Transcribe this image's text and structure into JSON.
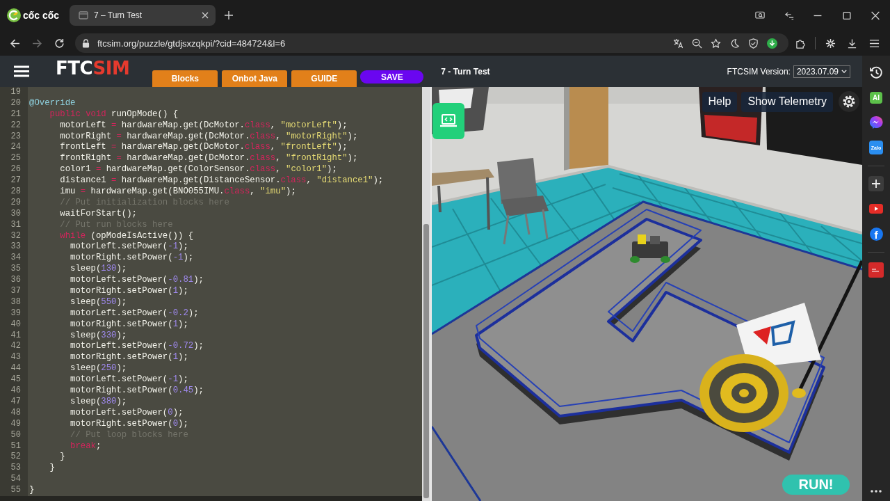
{
  "browser": {
    "brand": "cốc cốc",
    "tab_title": "7 – Turn Test",
    "url": "ftcsim.org/puzzle/gtdjsxzqkpi/?cid=484724&l=6"
  },
  "header": {
    "logo": {
      "text": "FTC",
      "accent": "SIM"
    },
    "tabs": [
      "Blocks",
      "Onbot Java",
      "GUIDE"
    ],
    "save": "SAVE",
    "title": "7 - Turn Test",
    "version_label": "FTCSIM Version:",
    "version": "2023.07.09"
  },
  "editor": {
    "lines": [
      {
        "number": "19"
      },
      {
        "number": "20",
        "tokens": [
          {
            "kind": "annotation",
            "text": "@Override"
          }
        ]
      },
      {
        "number": "21",
        "tokens": [
          {
            "kind": "keyword",
            "text": "    public void"
          },
          {
            "kind": "text",
            "text": " runOpMode() {"
          }
        ]
      },
      {
        "number": "22",
        "tokens": [
          {
            "kind": "text",
            "text": "      motorLeft "
          },
          {
            "kind": "keyword",
            "text": "="
          },
          {
            "kind": "text",
            "text": " hardwareMap.get(DcMotor."
          },
          {
            "kind": "keyword",
            "text": "class"
          },
          {
            "kind": "text",
            "text": ", "
          },
          {
            "kind": "string",
            "text": "\"motorLeft\""
          },
          {
            "kind": "text",
            "text": ");"
          }
        ]
      },
      {
        "number": "23",
        "tokens": [
          {
            "kind": "text",
            "text": "      motorRight "
          },
          {
            "kind": "keyword",
            "text": "="
          },
          {
            "kind": "text",
            "text": " hardwareMap.get(DcMotor."
          },
          {
            "kind": "keyword",
            "text": "class"
          },
          {
            "kind": "text",
            "text": ", "
          },
          {
            "kind": "string",
            "text": "\"motorRight\""
          },
          {
            "kind": "text",
            "text": ");"
          }
        ]
      },
      {
        "number": "24",
        "tokens": [
          {
            "kind": "text",
            "text": "      frontLeft "
          },
          {
            "kind": "keyword",
            "text": "="
          },
          {
            "kind": "text",
            "text": " hardwareMap.get(DcMotor."
          },
          {
            "kind": "keyword",
            "text": "class"
          },
          {
            "kind": "text",
            "text": ", "
          },
          {
            "kind": "string",
            "text": "\"frontLeft\""
          },
          {
            "kind": "text",
            "text": ");"
          }
        ]
      },
      {
        "number": "25",
        "tokens": [
          {
            "kind": "text",
            "text": "      frontRight "
          },
          {
            "kind": "keyword",
            "text": "="
          },
          {
            "kind": "text",
            "text": " hardwareMap.get(DcMotor."
          },
          {
            "kind": "keyword",
            "text": "class"
          },
          {
            "kind": "text",
            "text": ", "
          },
          {
            "kind": "string",
            "text": "\"frontRight\""
          },
          {
            "kind": "text",
            "text": ");"
          }
        ]
      },
      {
        "number": "26",
        "tokens": [
          {
            "kind": "text",
            "text": "      color1 "
          },
          {
            "kind": "keyword",
            "text": "="
          },
          {
            "kind": "text",
            "text": " hardwareMap.get(ColorSensor."
          },
          {
            "kind": "keyword",
            "text": "class"
          },
          {
            "kind": "text",
            "text": ", "
          },
          {
            "kind": "string",
            "text": "\"color1\""
          },
          {
            "kind": "text",
            "text": ");"
          }
        ]
      },
      {
        "number": "27",
        "tokens": [
          {
            "kind": "text",
            "text": "      distance1 "
          },
          {
            "kind": "keyword",
            "text": "="
          },
          {
            "kind": "text",
            "text": " hardwareMap.get(DistanceSensor."
          },
          {
            "kind": "keyword",
            "text": "class"
          },
          {
            "kind": "text",
            "text": ", "
          },
          {
            "kind": "string",
            "text": "\"distance1\""
          },
          {
            "kind": "text",
            "text": ");"
          }
        ]
      },
      {
        "number": "28",
        "tokens": [
          {
            "kind": "text",
            "text": "      imu "
          },
          {
            "kind": "keyword",
            "text": "="
          },
          {
            "kind": "text",
            "text": " hardwareMap.get(BNO055IMU."
          },
          {
            "kind": "keyword",
            "text": "class"
          },
          {
            "kind": "text",
            "text": ", "
          },
          {
            "kind": "string",
            "text": "\"imu\""
          },
          {
            "kind": "text",
            "text": ");"
          }
        ]
      },
      {
        "number": "29",
        "tokens": [
          {
            "kind": "comment",
            "text": "      // Put initialization blocks here"
          }
        ]
      },
      {
        "number": "30",
        "tokens": [
          {
            "kind": "text",
            "text": "      waitForStart();"
          }
        ]
      },
      {
        "number": "31",
        "tokens": [
          {
            "kind": "comment",
            "text": "      // Put run blocks here"
          }
        ]
      },
      {
        "number": "32",
        "tokens": [
          {
            "kind": "keyword",
            "text": "      while"
          },
          {
            "kind": "text",
            "text": " (opModeIsActive()) {"
          }
        ]
      },
      {
        "number": "33",
        "tokens": [
          {
            "kind": "text",
            "text": "        motorLeft.setPower("
          },
          {
            "kind": "number",
            "text": "-1"
          },
          {
            "kind": "text",
            "text": ");"
          }
        ]
      },
      {
        "number": "34",
        "tokens": [
          {
            "kind": "text",
            "text": "        motorRight.setPower("
          },
          {
            "kind": "number",
            "text": "-1"
          },
          {
            "kind": "text",
            "text": ");"
          }
        ]
      },
      {
        "number": "35",
        "tokens": [
          {
            "kind": "text",
            "text": "        sleep("
          },
          {
            "kind": "number",
            "text": "130"
          },
          {
            "kind": "text",
            "text": ");"
          }
        ]
      },
      {
        "number": "36",
        "tokens": [
          {
            "kind": "text",
            "text": "        motorLeft.setPower("
          },
          {
            "kind": "number",
            "text": "-0.81"
          },
          {
            "kind": "text",
            "text": ");"
          }
        ]
      },
      {
        "number": "37",
        "tokens": [
          {
            "kind": "text",
            "text": "        motorRight.setPower("
          },
          {
            "kind": "number",
            "text": "1"
          },
          {
            "kind": "text",
            "text": ");"
          }
        ]
      },
      {
        "number": "38",
        "tokens": [
          {
            "kind": "text",
            "text": "        sleep("
          },
          {
            "kind": "number",
            "text": "550"
          },
          {
            "kind": "text",
            "text": ");"
          }
        ]
      },
      {
        "number": "39",
        "tokens": [
          {
            "kind": "text",
            "text": "        motorLeft.setPower("
          },
          {
            "kind": "number",
            "text": "-0.2"
          },
          {
            "kind": "text",
            "text": ");"
          }
        ]
      },
      {
        "number": "40",
        "tokens": [
          {
            "kind": "text",
            "text": "        motorRight.setPower("
          },
          {
            "kind": "number",
            "text": "1"
          },
          {
            "kind": "text",
            "text": ");"
          }
        ]
      },
      {
        "number": "41",
        "tokens": [
          {
            "kind": "text",
            "text": "        sleep("
          },
          {
            "kind": "number",
            "text": "330"
          },
          {
            "kind": "text",
            "text": ");"
          }
        ]
      },
      {
        "number": "42",
        "tokens": [
          {
            "kind": "text",
            "text": "        motorLeft.setPower("
          },
          {
            "kind": "number",
            "text": "-0.72"
          },
          {
            "kind": "text",
            "text": ");"
          }
        ]
      },
      {
        "number": "43",
        "tokens": [
          {
            "kind": "text",
            "text": "        motorRight.setPower("
          },
          {
            "kind": "number",
            "text": "1"
          },
          {
            "kind": "text",
            "text": ");"
          }
        ]
      },
      {
        "number": "44",
        "tokens": [
          {
            "kind": "text",
            "text": "        sleep("
          },
          {
            "kind": "number",
            "text": "250"
          },
          {
            "kind": "text",
            "text": ");"
          }
        ]
      },
      {
        "number": "45",
        "tokens": [
          {
            "kind": "text",
            "text": "        motorLeft.setPower("
          },
          {
            "kind": "number",
            "text": "-1"
          },
          {
            "kind": "text",
            "text": ");"
          }
        ]
      },
      {
        "number": "46",
        "tokens": [
          {
            "kind": "text",
            "text": "        motorRight.setPower("
          },
          {
            "kind": "number",
            "text": "0.45"
          },
          {
            "kind": "text",
            "text": ");"
          }
        ]
      },
      {
        "number": "47",
        "tokens": [
          {
            "kind": "text",
            "text": "        sleep("
          },
          {
            "kind": "number",
            "text": "380"
          },
          {
            "kind": "text",
            "text": ");"
          }
        ]
      },
      {
        "number": "48",
        "tokens": [
          {
            "kind": "text",
            "text": "        motorLeft.setPower("
          },
          {
            "kind": "number",
            "text": "0"
          },
          {
            "kind": "text",
            "text": ");"
          }
        ]
      },
      {
        "number": "49",
        "tokens": [
          {
            "kind": "text",
            "text": "        motorRight.setPower("
          },
          {
            "kind": "number",
            "text": "0"
          },
          {
            "kind": "text",
            "text": ");"
          }
        ]
      },
      {
        "number": "50",
        "tokens": [
          {
            "kind": "comment",
            "text": "        // Put loop blocks here"
          }
        ]
      },
      {
        "number": "51",
        "tokens": [
          {
            "kind": "keyword",
            "text": "        break"
          },
          {
            "kind": "text",
            "text": ";"
          }
        ]
      },
      {
        "number": "52",
        "tokens": [
          {
            "kind": "text",
            "text": "      }"
          }
        ]
      },
      {
        "number": "53",
        "tokens": [
          {
            "kind": "text",
            "text": "    }"
          }
        ]
      },
      {
        "number": "54"
      },
      {
        "number": "55",
        "tokens": [
          {
            "kind": "text",
            "text": "}"
          }
        ]
      }
    ]
  },
  "simulator": {
    "help": "Help",
    "telemetry": "Show Telemetry",
    "run": "RUN!"
  },
  "browser_sidebar": {
    "ai": "AI",
    "chat_app": "Zalo",
    "social_app": "f"
  }
}
